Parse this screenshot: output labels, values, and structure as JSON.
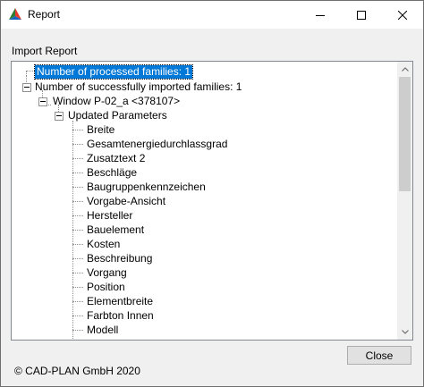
{
  "window": {
    "title": "Report"
  },
  "section": {
    "label": "Import Report"
  },
  "tree": {
    "processed": "Number of processed families: 1",
    "imported": "Number of successfully imported families: 1",
    "family": "Window P-02_a <378107>",
    "group": "Updated Parameters",
    "params": [
      "Breite",
      "Gesamtenergiedurchlassgrad",
      "Zusatztext 2",
      "Beschläge",
      "Baugruppenkennzeichen",
      "Vorgabe-Ansicht",
      "Hersteller",
      "Bauelement",
      "Kosten",
      "Beschreibung",
      "Vorgang",
      "Position",
      "Elementbreite",
      "Farbton Innen",
      "Modell"
    ]
  },
  "buttons": {
    "close": "Close"
  },
  "footer": {
    "copyright": "© CAD-PLAN GmbH 2020"
  }
}
